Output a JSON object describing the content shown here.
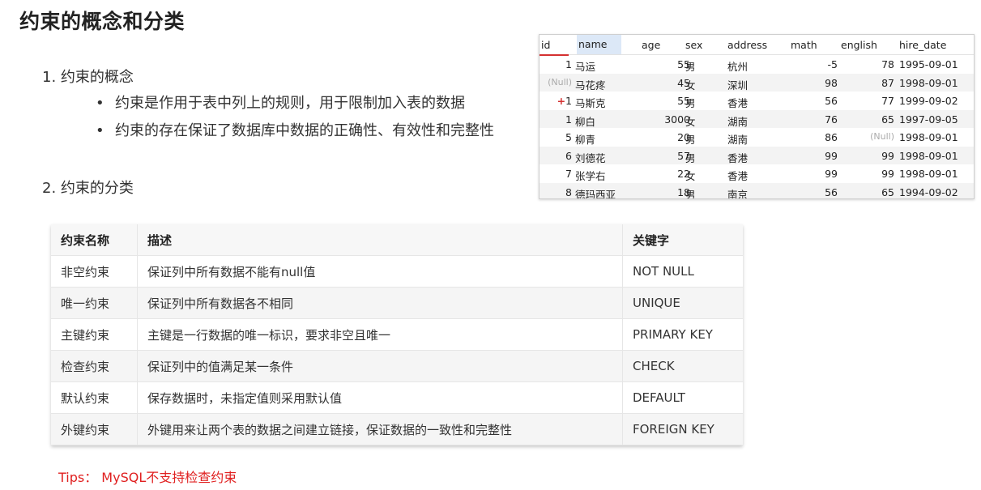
{
  "title": "约束的概念和分类",
  "section1": "1. 约束的概念",
  "bullets": [
    "约束是作用于表中列上的规则，用于限制加入表的数据",
    "约束的存在保证了数据库中数据的正确性、有效性和完整性"
  ],
  "bullet_glyph": "•",
  "section2": "2. 约束的分类",
  "db_table": {
    "headers": [
      "id",
      "name",
      "age",
      "sex",
      "address",
      "math",
      "english",
      "hire_date"
    ],
    "rows": [
      {
        "id": "1",
        "name": "马运",
        "age": "55",
        "sex": "男",
        "address": "杭州",
        "math": "-5",
        "english": "78",
        "hire_date": "1995-09-01"
      },
      {
        "id": "(Null)",
        "name": "马花疼",
        "age": "45",
        "sex": "女",
        "address": "深圳",
        "math": "98",
        "english": "87",
        "hire_date": "1998-09-01"
      },
      {
        "id": "1",
        "id_prefix": "+",
        "name": "马斯克",
        "age": "55",
        "sex": "男",
        "address": "香港",
        "math": "56",
        "english": "77",
        "hire_date": "1999-09-02"
      },
      {
        "id": "1",
        "name": "柳白",
        "age": "3000",
        "sex": "女",
        "address": "湖南",
        "math": "76",
        "english": "65",
        "hire_date": "1997-09-05"
      },
      {
        "id": "5",
        "name": "柳青",
        "age": "20",
        "sex": "男",
        "address": "湖南",
        "math": "86",
        "english": "(Null)",
        "hire_date": "1998-09-01"
      },
      {
        "id": "6",
        "name": "刘德花",
        "age": "57",
        "sex": "男",
        "address": "香港",
        "math": "99",
        "english": "99",
        "hire_date": "1998-09-01"
      },
      {
        "id": "7",
        "name": "张学右",
        "age": "22",
        "sex": "女",
        "address": "香港",
        "math": "99",
        "english": "99",
        "hire_date": "1998-09-01"
      },
      {
        "id": "8",
        "name": "德玛西亚",
        "age": "18",
        "sex": "男",
        "address": "南京",
        "math": "56",
        "english": "65",
        "hire_date": "1994-09-02"
      }
    ]
  },
  "constraints_table": {
    "headers": [
      "约束名称",
      "描述",
      "关键字"
    ],
    "rows": [
      [
        "非空约束",
        "保证列中所有数据不能有null值",
        "NOT NULL"
      ],
      [
        "唯一约束",
        "保证列中所有数据各不相同",
        "UNIQUE"
      ],
      [
        "主键约束",
        "主键是一行数据的唯一标识，要求非空且唯一",
        "PRIMARY KEY"
      ],
      [
        "检查约束",
        "保证列中的值满足某一条件",
        "CHECK"
      ],
      [
        "默认约束",
        "保存数据时，未指定值则采用默认值",
        "DEFAULT"
      ],
      [
        "外键约束",
        "外键用来让两个表的数据之间建立链接，保证数据的一致性和完整性",
        "FOREIGN KEY"
      ]
    ]
  },
  "tips": "Tips：  MySQL不支持检查约束",
  "colors": {
    "tips": "#e02020",
    "null_text": "#aaaaaa",
    "row_stripe": "#f3f3f3"
  }
}
